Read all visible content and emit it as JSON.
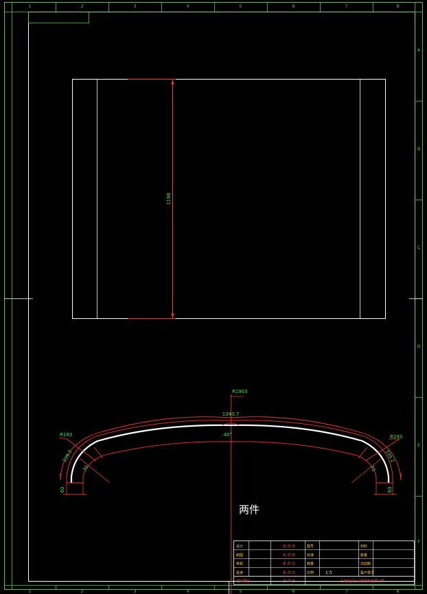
{
  "border": {
    "columns": [
      "1",
      "2",
      "3",
      "4",
      "5",
      "6",
      "7",
      "8"
    ],
    "rows": [
      "A",
      "B",
      "C",
      "D",
      "E",
      "F"
    ]
  },
  "dimensions": {
    "height": "1198",
    "radius_main": "R1903",
    "arc_length": "1340.7",
    "angle": "40°",
    "radius_left": "R193",
    "radius_right": "R193",
    "arc_left": "339.2",
    "arc_right": "339.2",
    "width_left": "70",
    "width_right": "70",
    "leg_left": "60",
    "leg_right": "60"
  },
  "note": "两件",
  "title_block": {
    "rows": [
      {
        "label": "设计",
        "date": "年 月 日",
        "field": "图号",
        "right": "材料"
      },
      {
        "label": "制图",
        "date": "年 月 日",
        "field": "标准",
        "right": "数量"
      },
      {
        "label": "审核",
        "date": "年 月 日",
        "field": "数量",
        "right": "共回数"
      },
      {
        "label": "批准",
        "date": "年 月 日",
        "field": "比例",
        "scale": "1:5",
        "right": "客户签字"
      }
    ],
    "footer_label": "客户确认",
    "footer_date": "年 月 日",
    "company": "上海恩达工业钢结构有限公司"
  }
}
